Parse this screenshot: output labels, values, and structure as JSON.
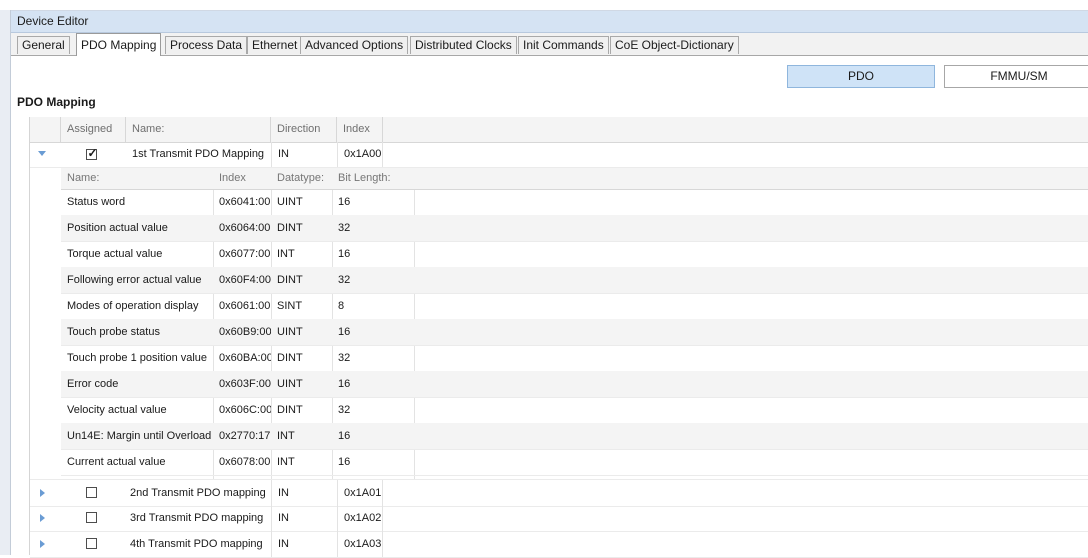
{
  "editor": {
    "title": "Device Editor"
  },
  "tabs": [
    {
      "label": "General",
      "active": false
    },
    {
      "label": "PDO Mapping",
      "active": true
    },
    {
      "label": "Process Data",
      "active": false
    },
    {
      "label": "Ethernet",
      "active": false
    },
    {
      "label": "Advanced Options",
      "active": false
    },
    {
      "label": "Distributed Clocks",
      "active": false
    },
    {
      "label": "Init Commands",
      "active": false
    },
    {
      "label": "CoE Object-Dictionary",
      "active": false
    }
  ],
  "view_buttons": {
    "pdo": "PDO",
    "fmmu": "FMMU/SM"
  },
  "section": {
    "title": "PDO Mapping"
  },
  "main_headers": {
    "assigned": "Assigned",
    "name": "Name:",
    "direction": "Direction",
    "index": "Index"
  },
  "sub_headers": {
    "name": "Name:",
    "index": "Index",
    "datatype": "Datatype:",
    "bitlength": "Bit Length:"
  },
  "pdos": [
    {
      "name": "1st Transmit PDO Mapping",
      "direction": "IN",
      "index": "0x1A00",
      "assigned": true,
      "expanded": true
    },
    {
      "name": "2nd Transmit PDO mapping",
      "direction": "IN",
      "index": "0x1A01",
      "assigned": false,
      "expanded": false
    },
    {
      "name": "3rd Transmit PDO mapping",
      "direction": "IN",
      "index": "0x1A02",
      "assigned": false,
      "expanded": false
    },
    {
      "name": "4th Transmit PDO mapping",
      "direction": "IN",
      "index": "0x1A03",
      "assigned": false,
      "expanded": false
    }
  ],
  "entries": [
    {
      "name": "Status word",
      "index": "0x6041:00",
      "datatype": "UINT",
      "bitlength": "16"
    },
    {
      "name": "Position actual value",
      "index": "0x6064:00",
      "datatype": "DINT",
      "bitlength": "32"
    },
    {
      "name": "Torque actual value",
      "index": "0x6077:00",
      "datatype": "INT",
      "bitlength": "16"
    },
    {
      "name": "Following error actual value",
      "index": "0x60F4:00",
      "datatype": "DINT",
      "bitlength": "32"
    },
    {
      "name": "Modes of operation display",
      "index": "0x6061:00",
      "datatype": "SINT",
      "bitlength": "8"
    },
    {
      "name": "Touch probe status",
      "index": "0x60B9:00",
      "datatype": "UINT",
      "bitlength": "16"
    },
    {
      "name": "Touch probe 1 position value",
      "index": "0x60BA:00",
      "datatype": "DINT",
      "bitlength": "32"
    },
    {
      "name": "Error code",
      "index": "0x603F:00",
      "datatype": "UINT",
      "bitlength": "16"
    },
    {
      "name": "Velocity actual value",
      "index": "0x606C:00",
      "datatype": "DINT",
      "bitlength": "32"
    },
    {
      "name": "Un14E: Margin until Overload",
      "index": "0x2770:17",
      "datatype": "INT",
      "bitlength": "16"
    },
    {
      "name": "Current actual value",
      "index": "0x6078:00",
      "datatype": "INT",
      "bitlength": "16"
    }
  ],
  "icons": {
    "expanded": "chevron-down-icon",
    "collapsed": "chevron-right-icon",
    "check": "checkmark-icon"
  },
  "colors": {
    "accent": "#cfe3f7",
    "titlebar": "#d5e3f3",
    "arrow": "#6a9cd4"
  }
}
